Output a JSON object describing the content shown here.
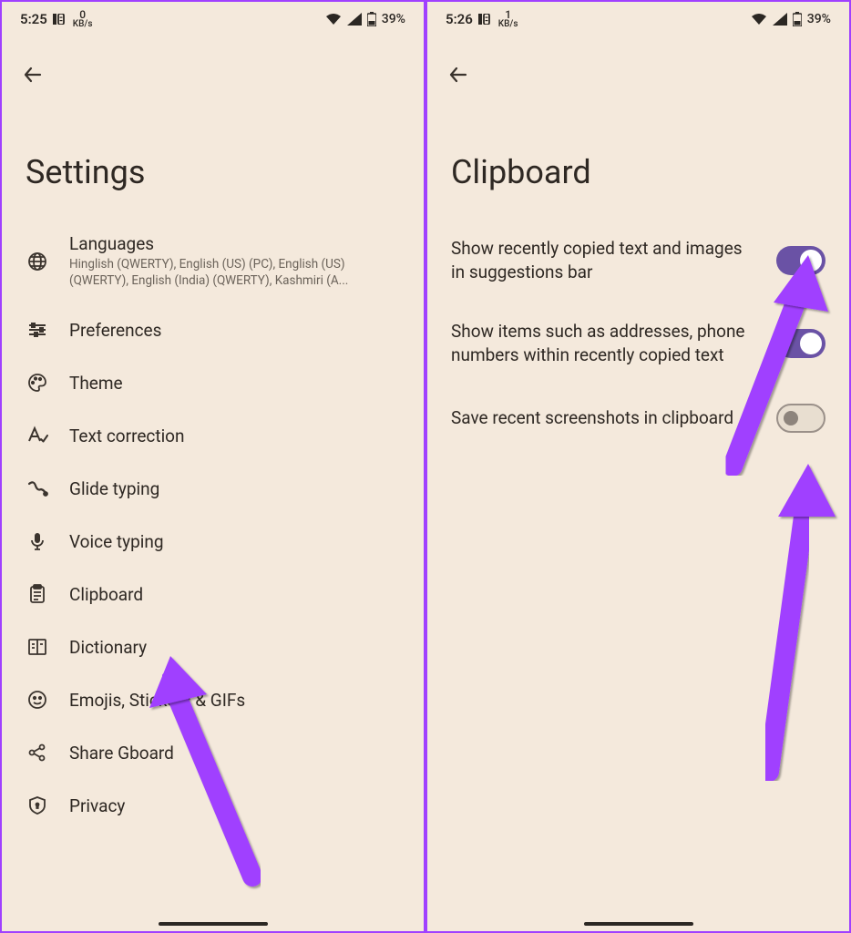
{
  "left": {
    "status": {
      "time": "5:25",
      "net_speed": "0",
      "net_unit": "KB/s",
      "battery": "39%"
    },
    "title": "Settings",
    "items": [
      {
        "icon": "globe-icon",
        "label": "Languages",
        "sub": "Hinglish (QWERTY), English (US) (PC), English (US) (QWERTY), English (India) (QWERTY), Kashmiri (A..."
      },
      {
        "icon": "sliders-icon",
        "label": "Preferences"
      },
      {
        "icon": "palette-icon",
        "label": "Theme"
      },
      {
        "icon": "text-correction-icon",
        "label": "Text correction"
      },
      {
        "icon": "glide-icon",
        "label": "Glide typing"
      },
      {
        "icon": "mic-icon",
        "label": "Voice typing"
      },
      {
        "icon": "clipboard-icon",
        "label": "Clipboard"
      },
      {
        "icon": "dictionary-icon",
        "label": "Dictionary"
      },
      {
        "icon": "emoji-icon",
        "label": "Emojis, Stickers & GIFs"
      },
      {
        "icon": "share-icon",
        "label": "Share Gboard"
      },
      {
        "icon": "shield-icon",
        "label": "Privacy"
      }
    ]
  },
  "right": {
    "status": {
      "time": "5:26",
      "net_speed": "1",
      "net_unit": "KB/s",
      "battery": "39%"
    },
    "title": "Clipboard",
    "options": [
      {
        "label": "Show recently copied text and images in suggestions bar",
        "on": true
      },
      {
        "label": "Show items such as addresses, phone numbers within recently copied text",
        "on": true
      },
      {
        "label": "Save recent screenshots in clipboard",
        "on": false
      }
    ]
  },
  "colors": {
    "bg": "#f4e9dc",
    "text": "#2e2823",
    "accent": "#6a52a5",
    "annotation": "#a040ff"
  }
}
